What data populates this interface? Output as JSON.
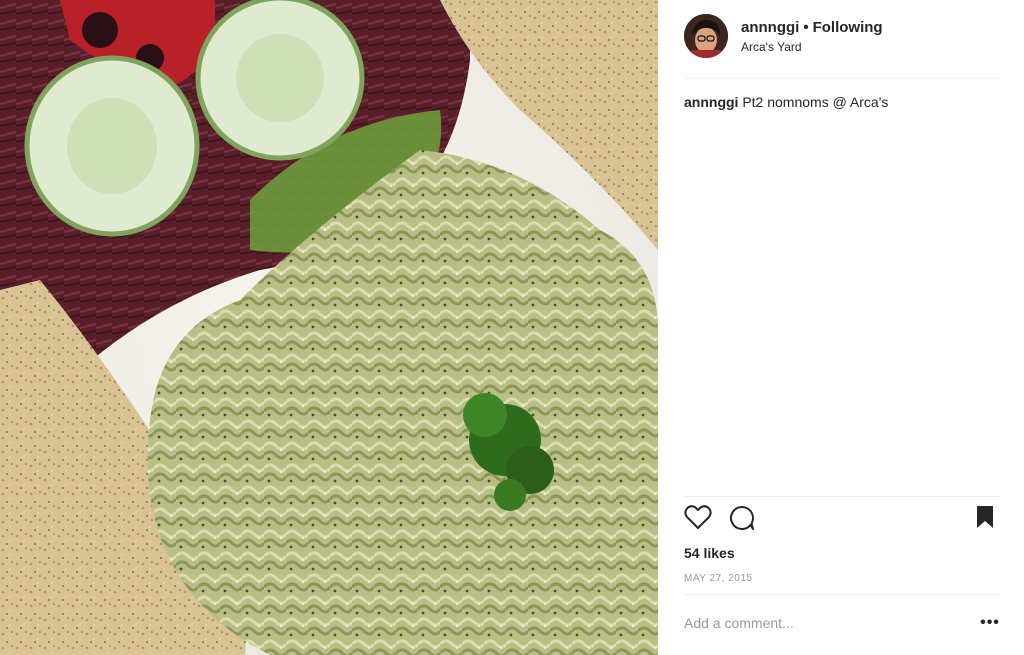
{
  "post": {
    "image_alt": "Pesto linguine with salad and garlic toast"
  },
  "header": {
    "username": "annnggi",
    "separator": "•",
    "follow_status": "Following",
    "location": "Arca's Yard"
  },
  "caption": {
    "username": "annnggi",
    "text": "Pt2 nomnoms @ Arca's"
  },
  "actions": {
    "like_icon": "heart-icon",
    "comment_icon": "comment-bubble-icon",
    "save_icon": "bookmark-icon"
  },
  "likes": "54 likes",
  "date": "MAY 27, 2015",
  "comment_box": {
    "placeholder": "Add a comment...",
    "more_label": "•••"
  },
  "colors": {
    "text": "#262626",
    "muted": "#999999",
    "divider": "#efefef"
  }
}
